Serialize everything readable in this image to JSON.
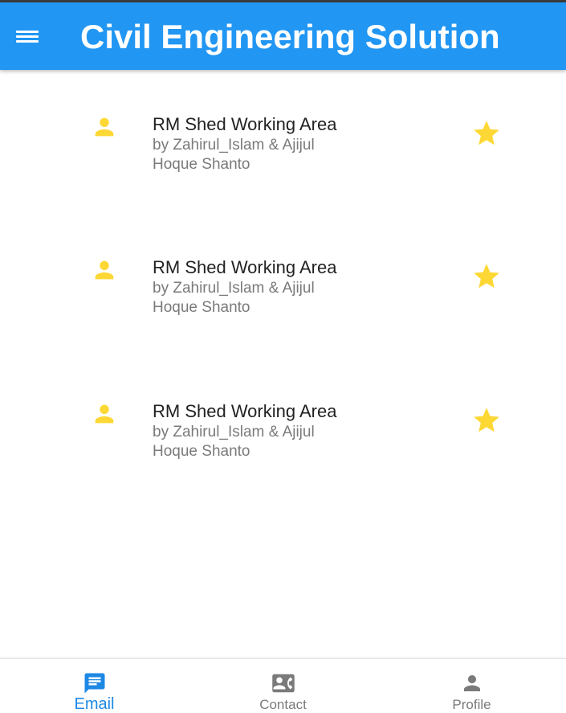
{
  "app_bar": {
    "menu_icon": "hamburger-menu-icon",
    "title": "Civil Engineering Solution",
    "color": "#2196f3"
  },
  "list": {
    "items": [
      {
        "title": "RM Shed Working Area",
        "author": "by Zahirul_Islam & Ajijul Hoque Shanto",
        "avatar_icon": "person-icon",
        "action_icon": "star-icon"
      },
      {
        "title": "RM Shed Working Area",
        "author": "by Zahirul_Islam & Ajijul Hoque Shanto",
        "avatar_icon": "person-icon",
        "action_icon": "star-icon"
      },
      {
        "title": "RM Shed Working Area",
        "author": "by Zahirul_Islam & Ajijul Hoque Shanto",
        "avatar_icon": "person-icon",
        "action_icon": "star-icon"
      }
    ],
    "accent_color": "#fdd835"
  },
  "bottom_nav": {
    "items": [
      {
        "label": "Email",
        "icon": "message-icon",
        "active": true
      },
      {
        "label": "Contact",
        "icon": "contact-card-icon",
        "active": false
      },
      {
        "label": "Profile",
        "icon": "person-icon",
        "active": false
      }
    ],
    "active_color": "#1e88e5",
    "inactive_color": "#7a7a7a"
  }
}
